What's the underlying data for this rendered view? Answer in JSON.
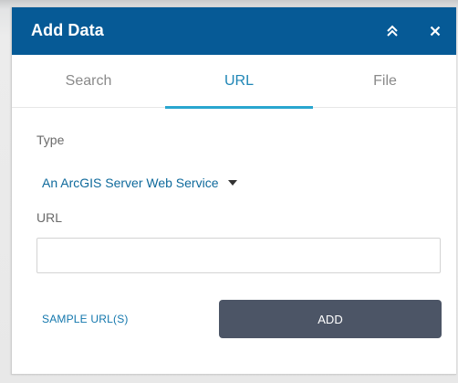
{
  "panel": {
    "title": "Add Data",
    "collapse_icon": "double-chevron-up-icon",
    "close_icon": "close-icon"
  },
  "tabs": [
    {
      "label": "Search",
      "active": false
    },
    {
      "label": "URL",
      "active": true
    },
    {
      "label": "File",
      "active": false
    }
  ],
  "form": {
    "type_label": "Type",
    "type_value": "An ArcGIS Server Web Service",
    "url_label": "URL",
    "url_value": "",
    "url_placeholder": "",
    "sample_link": "SAMPLE URL(S)",
    "add_button": "ADD"
  },
  "colors": {
    "header": "#065a96",
    "accent": "#2aa6cf",
    "link": "#0f6a9c",
    "button": "#4c5566"
  }
}
